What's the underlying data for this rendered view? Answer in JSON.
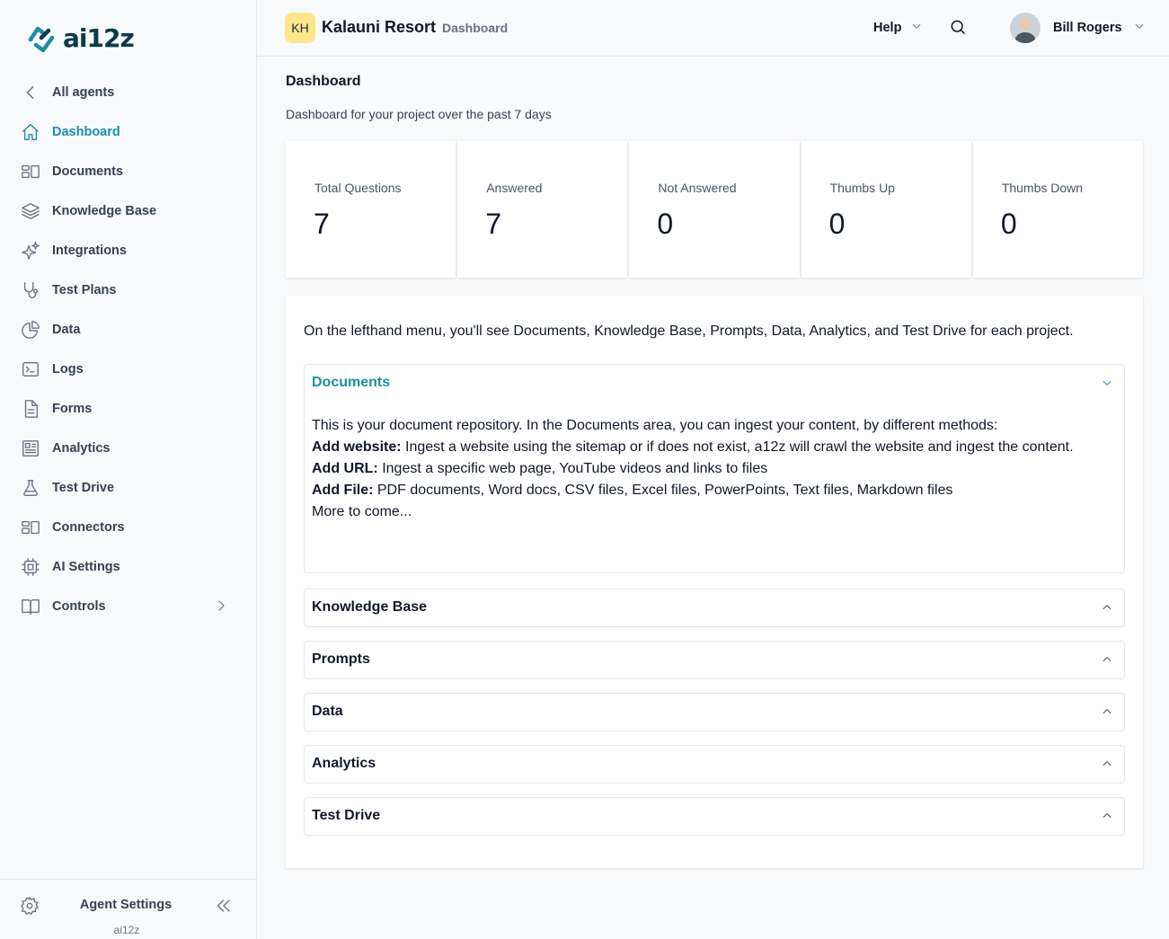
{
  "brand": {
    "logo_text": "ai12z",
    "accent": "#1a8fa6"
  },
  "sidebar": {
    "items": [
      {
        "label": "All agents",
        "icon": "chevron-left-icon"
      },
      {
        "label": "Dashboard",
        "icon": "home-icon",
        "active": true
      },
      {
        "label": "Documents",
        "icon": "documents-icon"
      },
      {
        "label": "Knowledge Base",
        "icon": "layers-icon"
      },
      {
        "label": "Integrations",
        "icon": "sparkles-icon"
      },
      {
        "label": "Test Plans",
        "icon": "stethoscope-icon"
      },
      {
        "label": "Data",
        "icon": "pie-chart-icon"
      },
      {
        "label": "Logs",
        "icon": "terminal-icon"
      },
      {
        "label": "Forms",
        "icon": "file-icon"
      },
      {
        "label": "Analytics",
        "icon": "newspaper-icon"
      },
      {
        "label": "Test Drive",
        "icon": "flask-icon"
      },
      {
        "label": "Connectors",
        "icon": "connectors-icon"
      },
      {
        "label": "AI Settings",
        "icon": "chip-icon"
      },
      {
        "label": "Controls",
        "icon": "book-icon"
      }
    ],
    "footer": {
      "title": "Agent Settings",
      "subtitle": "ai12z"
    }
  },
  "header": {
    "project_initials": "KH",
    "project_name": "Kalauni Resort",
    "current_page": "Dashboard",
    "help_label": "Help",
    "user_name": "Bill Rogers"
  },
  "main": {
    "title": "Dashboard",
    "subtitle": "Dashboard for your project over the past 7 days",
    "stats": [
      {
        "label": "Total Questions",
        "value": "7"
      },
      {
        "label": "Answered",
        "value": "7"
      },
      {
        "label": "Not Answered",
        "value": "0"
      },
      {
        "label": "Thumbs Up",
        "value": "0"
      },
      {
        "label": "Thumbs Down",
        "value": "0"
      }
    ],
    "intro": "On the lefthand menu, you'll see Documents, Knowledge Base, Prompts, Data, Analytics, and Test Drive for each project.",
    "documents": {
      "title": "Documents",
      "line1": "This is your document repository. In the Documents area, you can ingest your content, by different methods:",
      "website_label": "Add website:",
      "website_text": " Ingest a website using the sitemap or if does not exist, a12z will crawl the website and ingest the content.",
      "url_label": "Add URL:",
      "url_text": " Ingest a specific web page, YouTube videos and links to files",
      "file_label": "Add File:",
      "file_text": " PDF documents, Word docs, CSV files, Excel files, PowerPoints, Text files, Markdown files",
      "more": "More to come..."
    },
    "sections": [
      {
        "title": "Knowledge Base"
      },
      {
        "title": "Prompts"
      },
      {
        "title": "Data"
      },
      {
        "title": "Analytics"
      },
      {
        "title": "Test Drive"
      }
    ]
  }
}
